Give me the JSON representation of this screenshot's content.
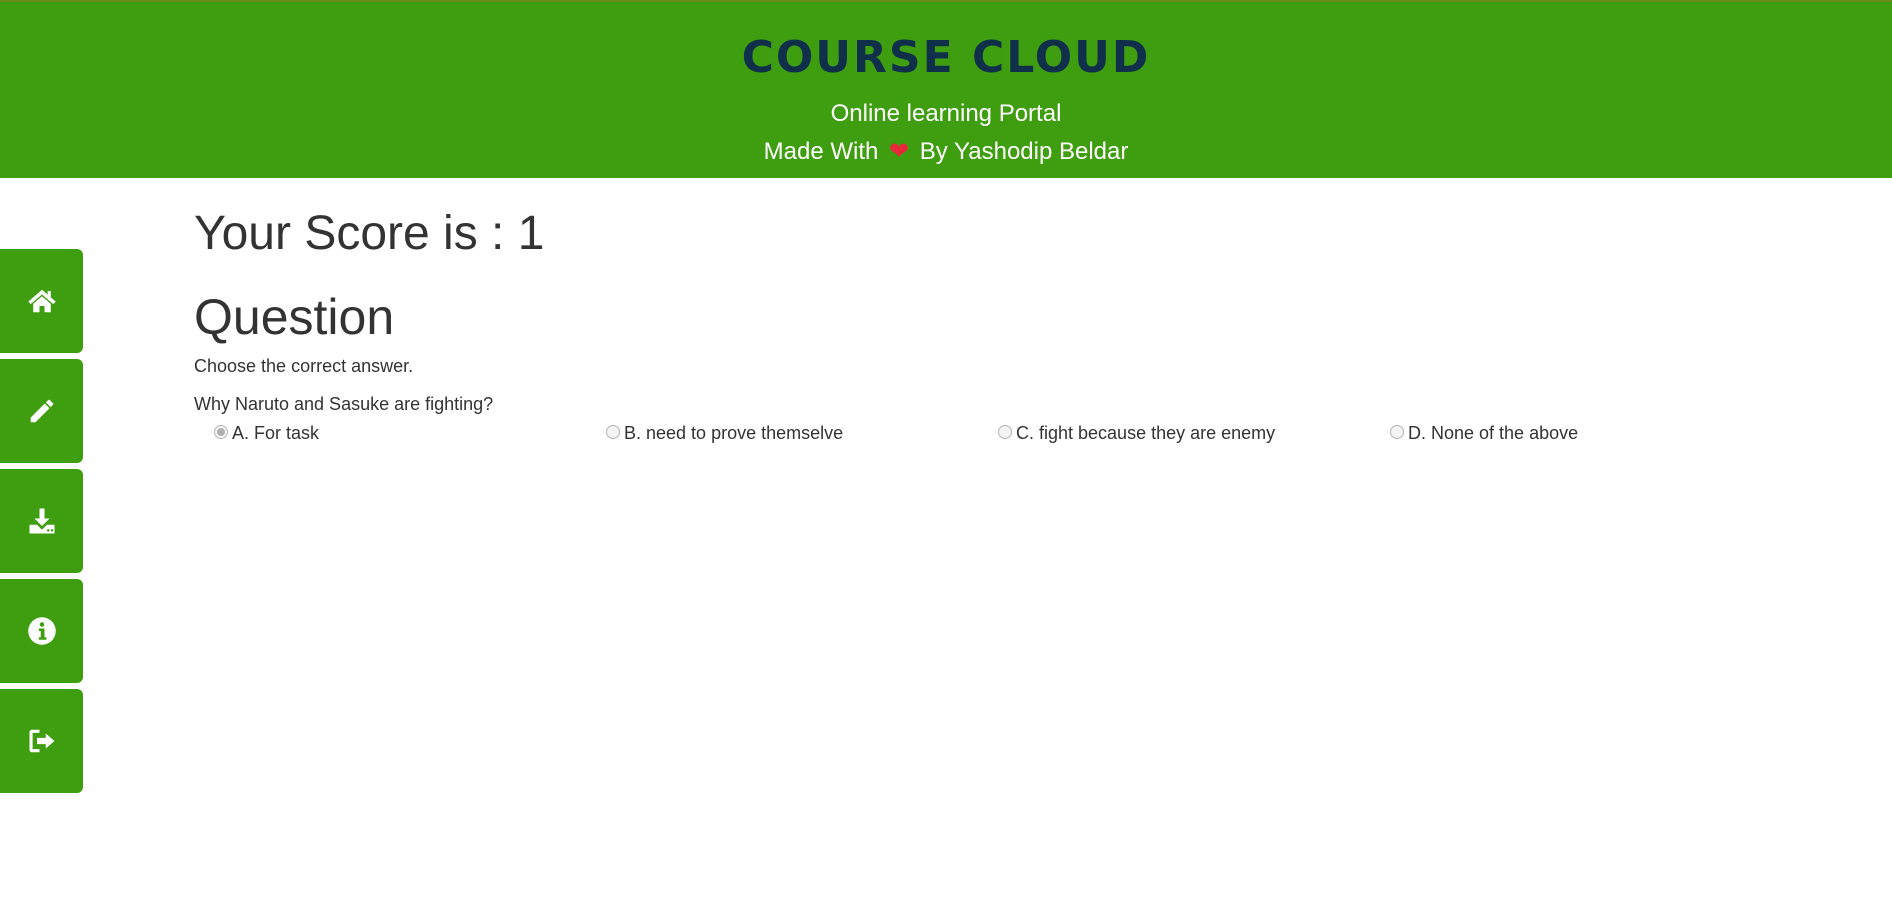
{
  "header": {
    "brand": "COURSE CLOUD",
    "tagline": "Online learning Portal",
    "made_with_prefix": "Made With",
    "heart_glyph": "❤",
    "made_with_suffix": "By Yashodip Beldar",
    "background_color": "#3f9e0f",
    "brand_color": "#0f2f4a"
  },
  "sidebar": {
    "items": [
      {
        "name": "home",
        "icon": "home-icon"
      },
      {
        "name": "edit",
        "icon": "pencil-icon"
      },
      {
        "name": "download",
        "icon": "download-icon"
      },
      {
        "name": "info",
        "icon": "info-icon"
      },
      {
        "name": "logout",
        "icon": "logout-icon"
      }
    ]
  },
  "main": {
    "score_text": "Your Score is : 1",
    "question_heading": "Question",
    "instruction": "Choose the correct answer.",
    "question": "Why Naruto and Sasuke are fighting?",
    "options": [
      {
        "label": "A. For task",
        "selected": true
      },
      {
        "label": "B. need to prove themselve",
        "selected": false
      },
      {
        "label": "C. fight because they are enemy",
        "selected": false
      },
      {
        "label": "D. None of the above",
        "selected": false
      }
    ]
  }
}
